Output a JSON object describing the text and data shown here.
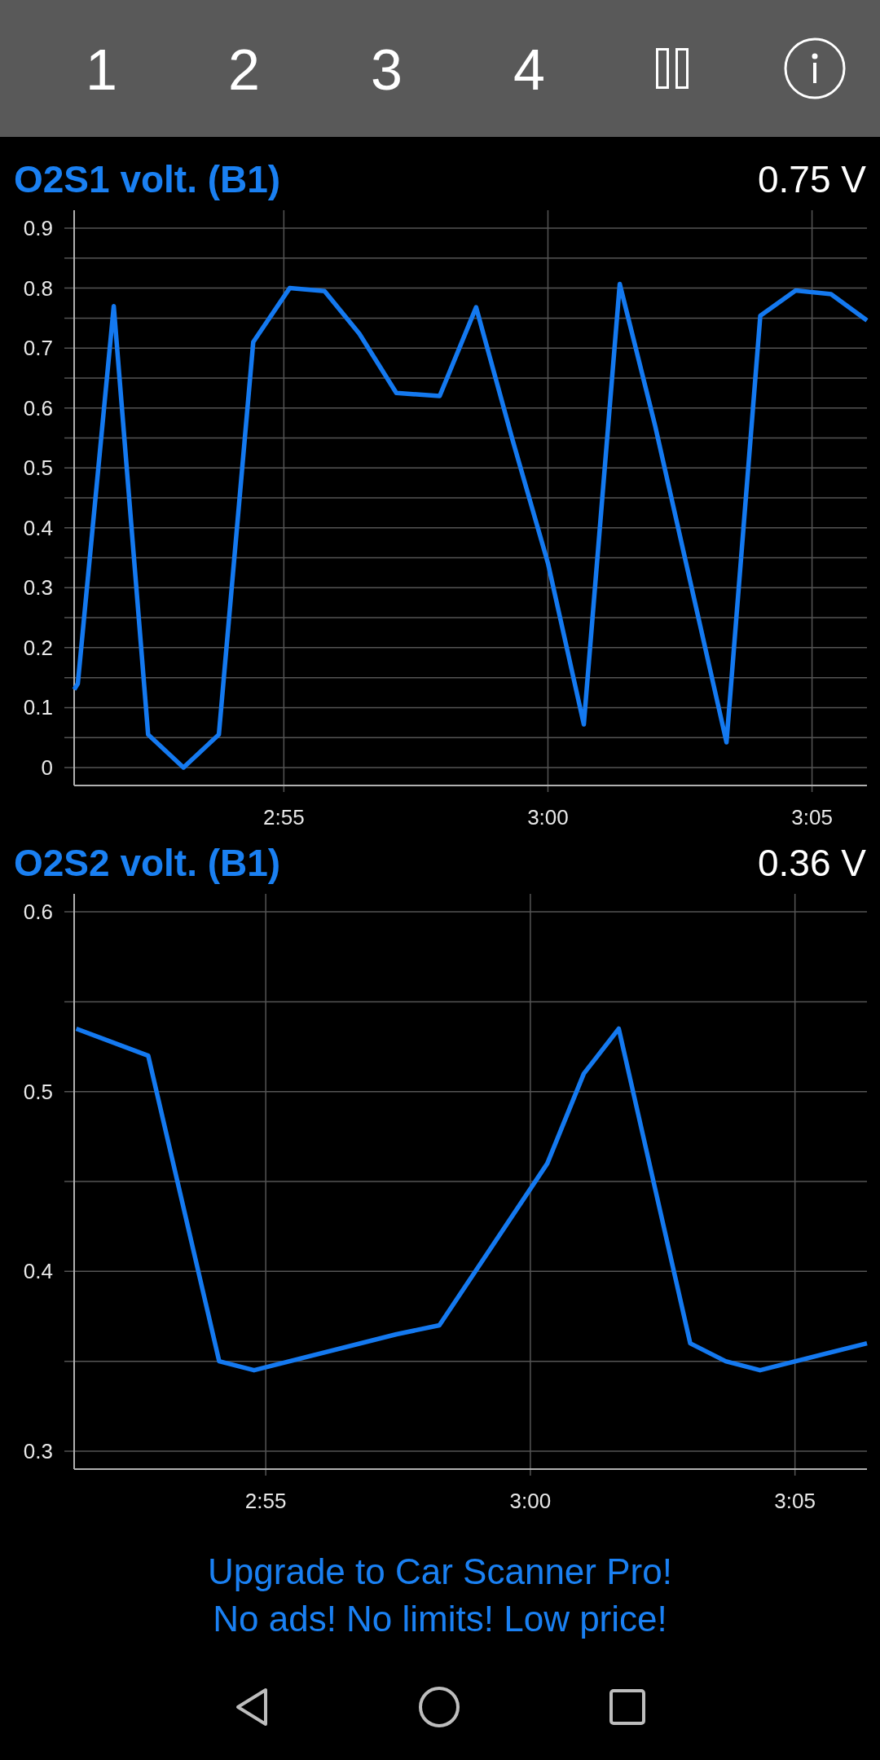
{
  "toolbar": {
    "pages": [
      {
        "label": "1"
      },
      {
        "label": "2"
      },
      {
        "label": "3"
      },
      {
        "label": "4"
      }
    ]
  },
  "charts": [
    {
      "reading": "0.75 V",
      "chart_data": {
        "type": "line",
        "title": "O2S1 volt. (B1)",
        "grid": true,
        "x": [
          171.03,
          171.1,
          171.78,
          172.43,
          173.1,
          173.77,
          174.42,
          175.11,
          175.77,
          176.43,
          177.13,
          177.95,
          178.64,
          179.33,
          180.0,
          180.68,
          181.36,
          182.03,
          183.38,
          184.02,
          184.69,
          185.36,
          186.04
        ],
        "values": [
          0.13,
          0.14,
          0.77,
          0.055,
          0,
          0.055,
          0.71,
          0.8,
          0.795,
          0.724,
          0.625,
          0.62,
          0.768,
          0.547,
          0.341,
          0.072,
          0.807,
          0.57,
          0.042,
          0.754,
          0.796,
          0.79,
          0.746
        ],
        "xlim": [
          171.03,
          186.04
        ],
        "ylim": [
          -0.03,
          0.93
        ],
        "xticks": [
          {
            "value": 175,
            "label": "2:55"
          },
          {
            "value": 180,
            "label": "3:00"
          },
          {
            "value": 185,
            "label": "3:05"
          }
        ],
        "yticks": [
          0,
          0.1,
          0.2,
          0.3,
          0.4,
          0.5,
          0.6,
          0.7,
          0.8,
          0.9
        ]
      }
    },
    {
      "reading": "0.36 V",
      "chart_data": {
        "type": "line",
        "title": "O2S2 volt. (B1)",
        "grid": true,
        "x": [
          171.42,
          172.78,
          174.12,
          174.78,
          177.47,
          178.28,
          180.32,
          181.01,
          181.67,
          183.02,
          183.69,
          184.34,
          186.36
        ],
        "values": [
          0.535,
          0.52,
          0.35,
          0.345,
          0.365,
          0.37,
          0.46,
          0.51,
          0.535,
          0.36,
          0.35,
          0.345,
          0.36
        ],
        "xlim": [
          171.38,
          186.36
        ],
        "ylim": [
          0.29,
          0.61
        ],
        "xticks": [
          {
            "value": 175,
            "label": "2:55"
          },
          {
            "value": 180,
            "label": "3:00"
          },
          {
            "value": 185,
            "label": "3:05"
          }
        ],
        "yticks": [
          0.3,
          0.4,
          0.5,
          0.6
        ]
      }
    }
  ],
  "promo": {
    "lines": [
      "Upgrade to Car Scanner Pro!",
      "No ads! No limits! Low price!"
    ]
  }
}
